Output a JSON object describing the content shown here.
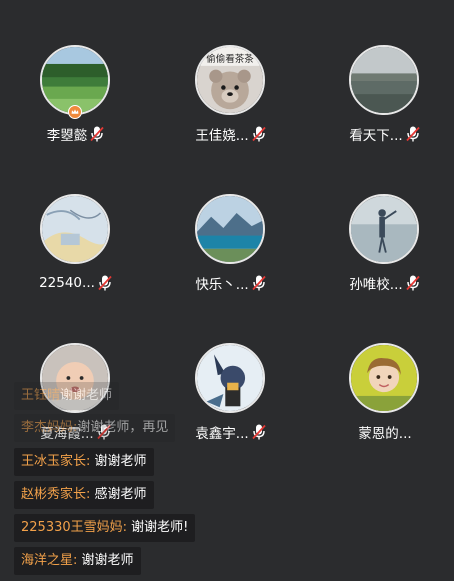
{
  "colors": {
    "background": "#2b2c2e",
    "username": "#f2a14a",
    "message": "#ffffff",
    "mic_muted": "#e53935",
    "host_badge": "#f08a3c"
  },
  "seats": [
    {
      "name": "李曌懿",
      "avatar": "green-landscape",
      "mic": "mic-muted-icon",
      "badge": "host-crown-icon"
    },
    {
      "name": "王佳娆...",
      "avatar": "teddy-bear",
      "avatar_text": "偷偷看茶茶",
      "mic": "mic-muted-icon"
    },
    {
      "name": "看天下...",
      "avatar": "lake-fog",
      "mic": "mic-muted-icon"
    },
    {
      "name": "22540...",
      "avatar": "sketch-art",
      "mic": "mic-muted-icon"
    },
    {
      "name": "快乐丶...",
      "avatar": "mountain-lake",
      "mic": "mic-muted-icon"
    },
    {
      "name": "孙唯校...",
      "avatar": "person-on-lake",
      "mic": "mic-muted-icon"
    },
    {
      "name": "夏海霞...",
      "avatar": "baby",
      "mic": "mic-muted-icon"
    },
    {
      "name": "袁鑫宇...",
      "avatar": "cartoon-character",
      "mic": "mic-muted-icon"
    },
    {
      "name": "蒙恩的...",
      "avatar": "girl-yellow",
      "mic": "none"
    }
  ],
  "chat": [
    {
      "user": "王钰晴",
      "message": "谢谢老师"
    },
    {
      "user": "李杰妈妈:",
      "message": "谢谢老师，再见"
    },
    {
      "user": "王冰玉家长:",
      "message": "谢谢老师"
    },
    {
      "user": "赵彬秀家长:",
      "message": "感谢老师"
    },
    {
      "user": "225330王雪妈妈:",
      "message": "谢谢老师!"
    },
    {
      "user": "海洋之星:",
      "message": "谢谢老师"
    }
  ]
}
